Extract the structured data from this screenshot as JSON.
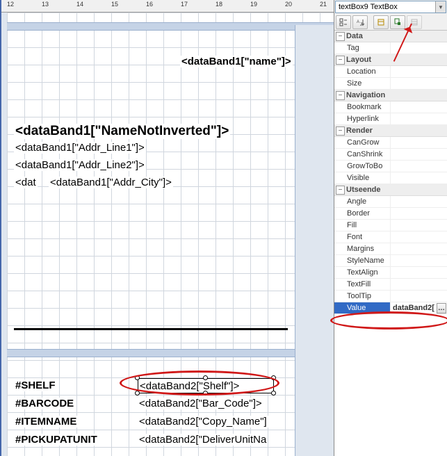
{
  "ruler": {
    "marks": [
      12,
      13,
      14,
      15,
      16,
      17,
      18,
      19,
      20,
      21
    ]
  },
  "design": {
    "name_field": "<dataBand1[\"name\"]>",
    "main_bold": "<dataBand1[\"NameNotInverted\"]>",
    "addr1": "<dataBand1[\"Addr_Line1\"]>",
    "addr2": "<dataBand1[\"Addr_Line2\"]>",
    "dat": "<dat",
    "city": "<dataBand1[\"Addr_City\"]>",
    "rows": [
      {
        "label": "#SHELF",
        "value": "<dataBand2[\"Shelf\"]>"
      },
      {
        "label": "#BARCODE",
        "value": "<dataBand2[\"Bar_Code\"]>"
      },
      {
        "label": "#ITEMNAME",
        "value": "<dataBand2[\"Copy_Name\"]"
      },
      {
        "label": "#PICKUPATUNIT",
        "value": "<dataBand2[\"DeliverUnitNa"
      }
    ]
  },
  "props": {
    "object_selector": "textBox9 TextBox",
    "categories": [
      {
        "name": "Data",
        "items": [
          {
            "name": "Tag",
            "value": ""
          }
        ]
      },
      {
        "name": "Layout",
        "items": [
          {
            "name": "Location",
            "value": ""
          },
          {
            "name": "Size",
            "value": ""
          }
        ]
      },
      {
        "name": "Navigation",
        "items": [
          {
            "name": "Bookmark",
            "value": ""
          },
          {
            "name": "Hyperlink",
            "value": ""
          }
        ]
      },
      {
        "name": "Render",
        "items": [
          {
            "name": "CanGrow",
            "value": ""
          },
          {
            "name": "CanShrink",
            "value": ""
          },
          {
            "name": "GrowToBo",
            "value": ""
          },
          {
            "name": "Visible",
            "value": ""
          }
        ]
      },
      {
        "name": "Utseende",
        "items": [
          {
            "name": "Angle",
            "value": ""
          },
          {
            "name": "Border",
            "value": ""
          },
          {
            "name": "Fill",
            "value": ""
          },
          {
            "name": "Font",
            "value": ""
          },
          {
            "name": "Margins",
            "value": ""
          },
          {
            "name": "StyleName",
            "value": ""
          },
          {
            "name": "TextAlign",
            "value": ""
          },
          {
            "name": "TextFill",
            "value": ""
          },
          {
            "name": "ToolTip",
            "value": ""
          },
          {
            "name": "Value",
            "value": "dataBand2[",
            "selected": true
          }
        ]
      }
    ]
  }
}
